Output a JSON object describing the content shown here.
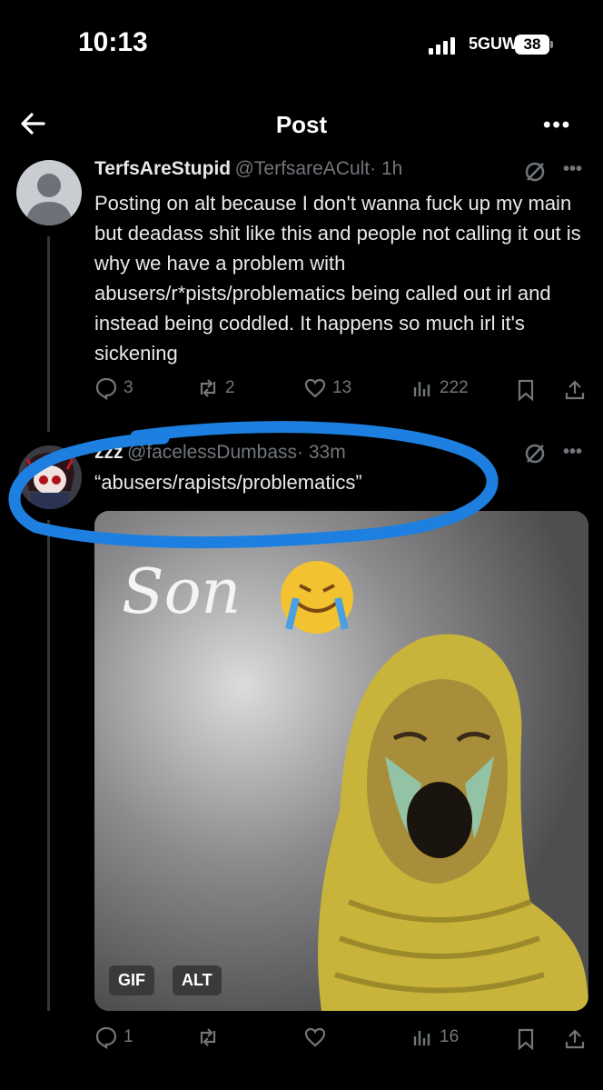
{
  "status": {
    "time": "10:13",
    "network": "5GUW",
    "battery": "38"
  },
  "header": {
    "title": "Post"
  },
  "post1": {
    "name": "TerfsAreStupid",
    "handle": "@TerfsareACult",
    "time": "· 1h",
    "text": "Posting on alt because I don't wanna fuck up my main but deadass shit like this and people not calling it out is why we have a problem with abusers/r*pists/problematics being called out irl and instead being coddled. It happens so much irl it's sickening",
    "replies": "3",
    "reposts": "2",
    "likes": "13",
    "views": "222"
  },
  "post2": {
    "name": "zzz",
    "handle": "@facelessDumbass",
    "time": "· 33m",
    "text": "“abusers/rapists/problematics”",
    "media_caption": "Son",
    "media_badges": [
      "GIF",
      "ALT"
    ],
    "replies": "1",
    "views": "16"
  },
  "colors": {
    "background": "#000000",
    "text": "#e7e9ea",
    "secondary": "#71767b",
    "annotation": "#1d7fe0"
  }
}
